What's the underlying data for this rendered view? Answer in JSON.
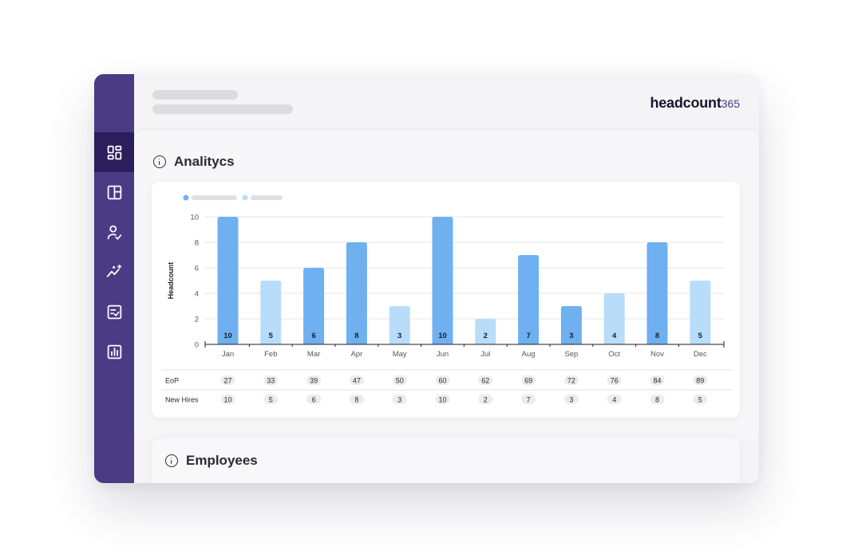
{
  "app": {
    "brand": "headcount",
    "brand_suffix": "365",
    "accent": "#4a3b85",
    "sidebar_active": "#2a1f5c"
  },
  "sidebar": {
    "items": [
      {
        "icon": "dashboard-icon",
        "active": true
      },
      {
        "icon": "layout-icon",
        "active": false
      },
      {
        "icon": "user-check-icon",
        "active": false
      },
      {
        "icon": "trend-sparkle-icon",
        "active": false
      },
      {
        "icon": "checklist-icon",
        "active": false
      },
      {
        "icon": "bar-chart-icon",
        "active": false
      }
    ]
  },
  "analytics": {
    "title": "Analitycs"
  },
  "employees": {
    "title": "Employees"
  },
  "chart_data": {
    "type": "bar",
    "categories": [
      "Jan",
      "Feb",
      "Mar",
      "Apr",
      "May",
      "Jun",
      "Jul",
      "Aug",
      "Sep",
      "Oct",
      "Nov",
      "Dec"
    ],
    "values": [
      10,
      5,
      6,
      8,
      3,
      10,
      2,
      7,
      3,
      4,
      8,
      5
    ],
    "ylabel": "Headcount",
    "xlabel": "",
    "ylim": [
      0,
      10
    ],
    "yticks": [
      0,
      2,
      4,
      6,
      8,
      10
    ],
    "grid": true,
    "legend": "top-left",
    "colors": {
      "strong": "#6fb0f0",
      "light": "#b8ddfa"
    },
    "table": {
      "rows": [
        {
          "label": "EoP",
          "values": [
            27,
            33,
            39,
            47,
            50,
            60,
            62,
            69,
            72,
            76,
            84,
            89
          ]
        },
        {
          "label": "New Hires",
          "values": [
            10,
            5,
            6,
            8,
            3,
            10,
            2,
            7,
            3,
            4,
            8,
            5
          ]
        }
      ]
    }
  }
}
